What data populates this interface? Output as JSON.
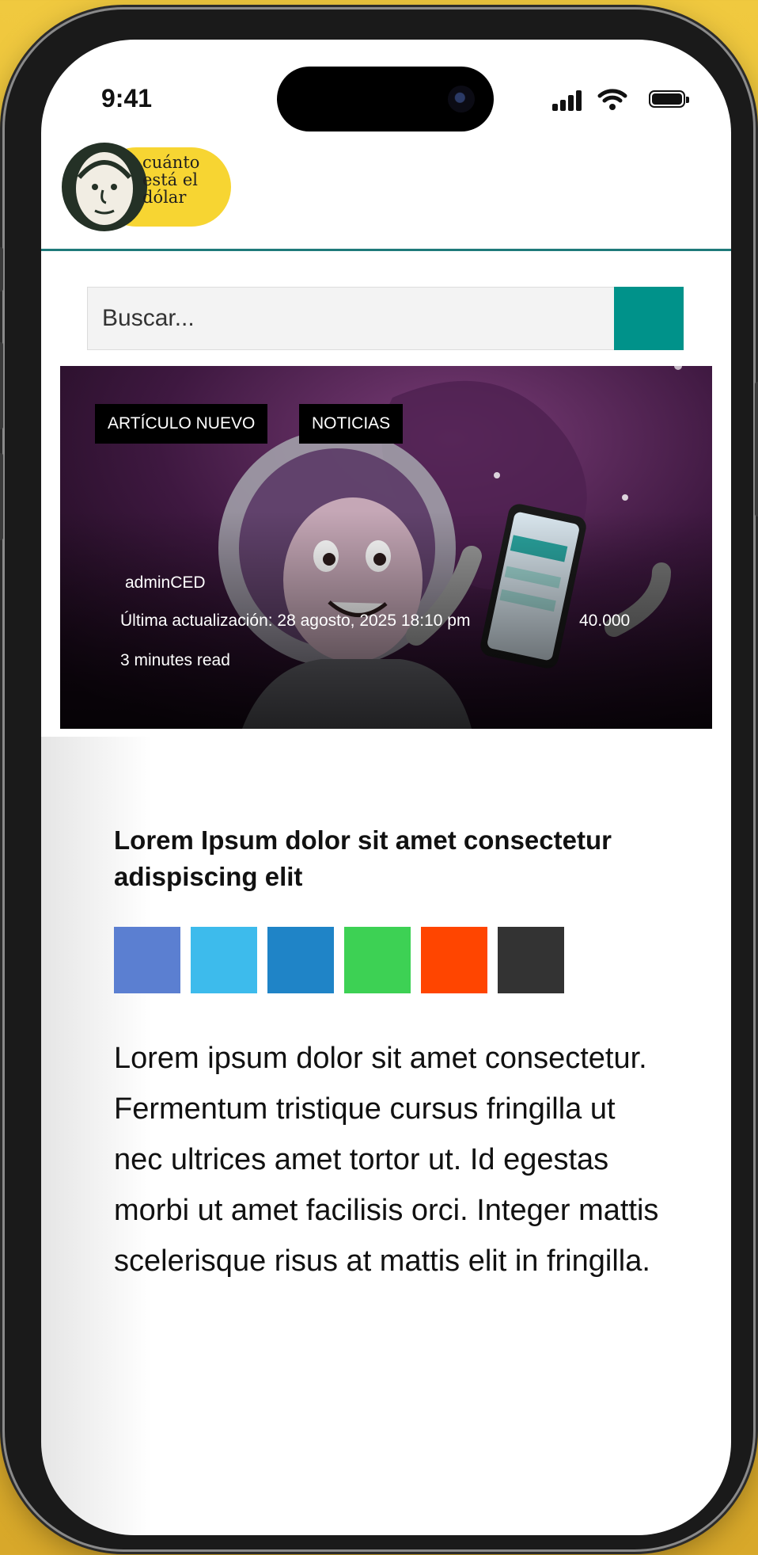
{
  "status_bar": {
    "time": "9:41"
  },
  "site": {
    "logo_text": [
      "cuánto",
      "está el",
      "dólar"
    ]
  },
  "search": {
    "placeholder": "Buscar..."
  },
  "hero": {
    "tags": [
      "ARTÍCULO NUEVO",
      "NOTICIAS"
    ],
    "author": "adminCED",
    "updated": "Última actualización: 28 agosto, 2025 18:10 pm",
    "views": "40.000",
    "read_time": "3 minutes read"
  },
  "article": {
    "title": "Lorem Ipsum dolor sit amet consectetur adispiscing elit",
    "body": "Lorem ipsum dolor sit amet consectetur. Fermentum tristique cursus fringilla ut nec ultrices amet tortor ut. Id egestas morbi ut amet facilisis orci. Integer mattis scelerisque risus at mattis elit in fringilla."
  },
  "share_buttons": [
    {
      "name": "share-facebook-button",
      "color": "#5b7fd1"
    },
    {
      "name": "share-twitter-button",
      "color": "#3dbbec"
    },
    {
      "name": "share-linkedin-button",
      "color": "#1f84c7"
    },
    {
      "name": "share-whatsapp-button",
      "color": "#3dd154"
    },
    {
      "name": "share-reddit-button",
      "color": "#ff4500"
    },
    {
      "name": "share-email-button",
      "color": "#333333"
    }
  ],
  "colors": {
    "accent": "#00928a",
    "logo_yellow": "#f7d532",
    "header_rule": "#1f7a7a"
  }
}
